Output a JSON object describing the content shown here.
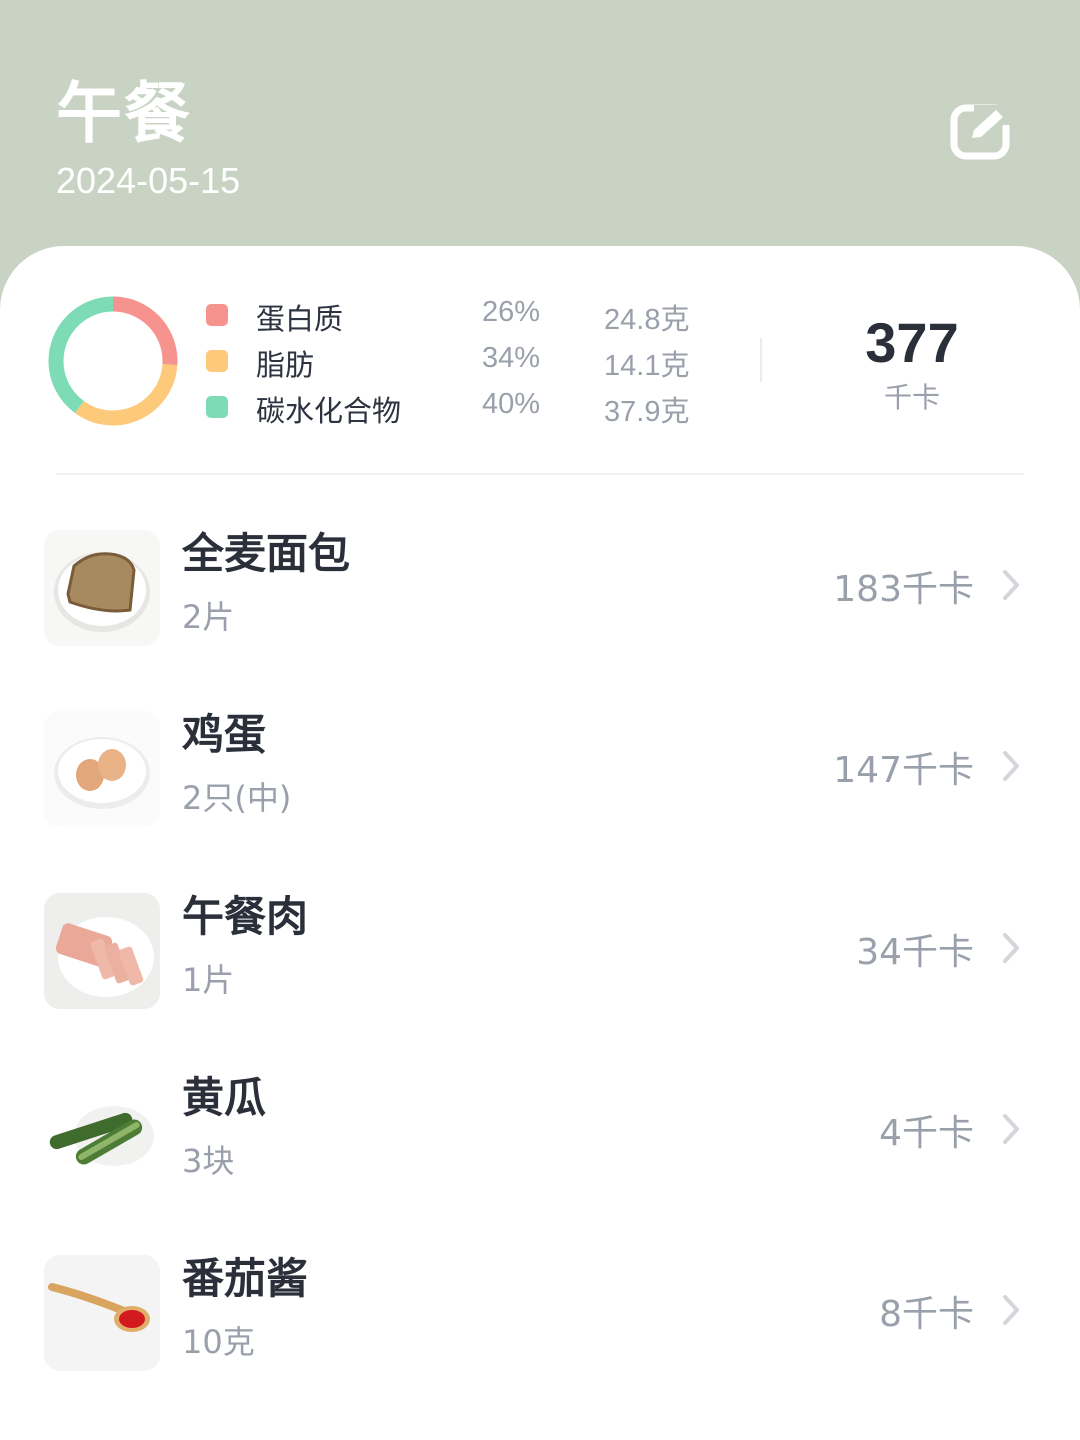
{
  "header": {
    "title": "午餐",
    "date": "2024-05-15",
    "edit_icon": "edit-icon"
  },
  "summary": {
    "chart_data": {
      "type": "pie",
      "categories": [
        "蛋白质",
        "脂肪",
        "碳水化合物"
      ],
      "values": [
        26,
        34,
        40
      ],
      "colors": [
        "#f7938f",
        "#fdca7c",
        "#7ddcb6"
      ]
    },
    "nutrients": [
      {
        "name": "蛋白质",
        "percent": "26%",
        "grams": "24.8克",
        "color": "#f7938f"
      },
      {
        "name": "脂肪",
        "percent": "34%",
        "grams": "14.1克",
        "color": "#fdca7c"
      },
      {
        "name": "碳水化合物",
        "percent": "40%",
        "grams": "37.9克",
        "color": "#7ddcb6"
      }
    ],
    "kcal": "377",
    "kcal_unit": "千卡"
  },
  "foods": [
    {
      "name": "全麦面包",
      "qty": "2片",
      "kcal": "183千卡",
      "image": "whole-wheat-bread"
    },
    {
      "name": "鸡蛋",
      "qty": "2只(中)",
      "kcal": "147千卡",
      "image": "eggs"
    },
    {
      "name": "午餐肉",
      "qty": "1片",
      "kcal": "34千卡",
      "image": "luncheon-meat"
    },
    {
      "name": "黄瓜",
      "qty": "3块",
      "kcal": "4千卡",
      "image": "cucumber"
    },
    {
      "name": "番茄酱",
      "qty": "10克",
      "kcal": "8千卡",
      "image": "ketchup"
    }
  ],
  "colors": {
    "header_bg": "#c9d3c3",
    "accent_text": "#2a2f3a",
    "muted_text": "#9aa0ab"
  }
}
